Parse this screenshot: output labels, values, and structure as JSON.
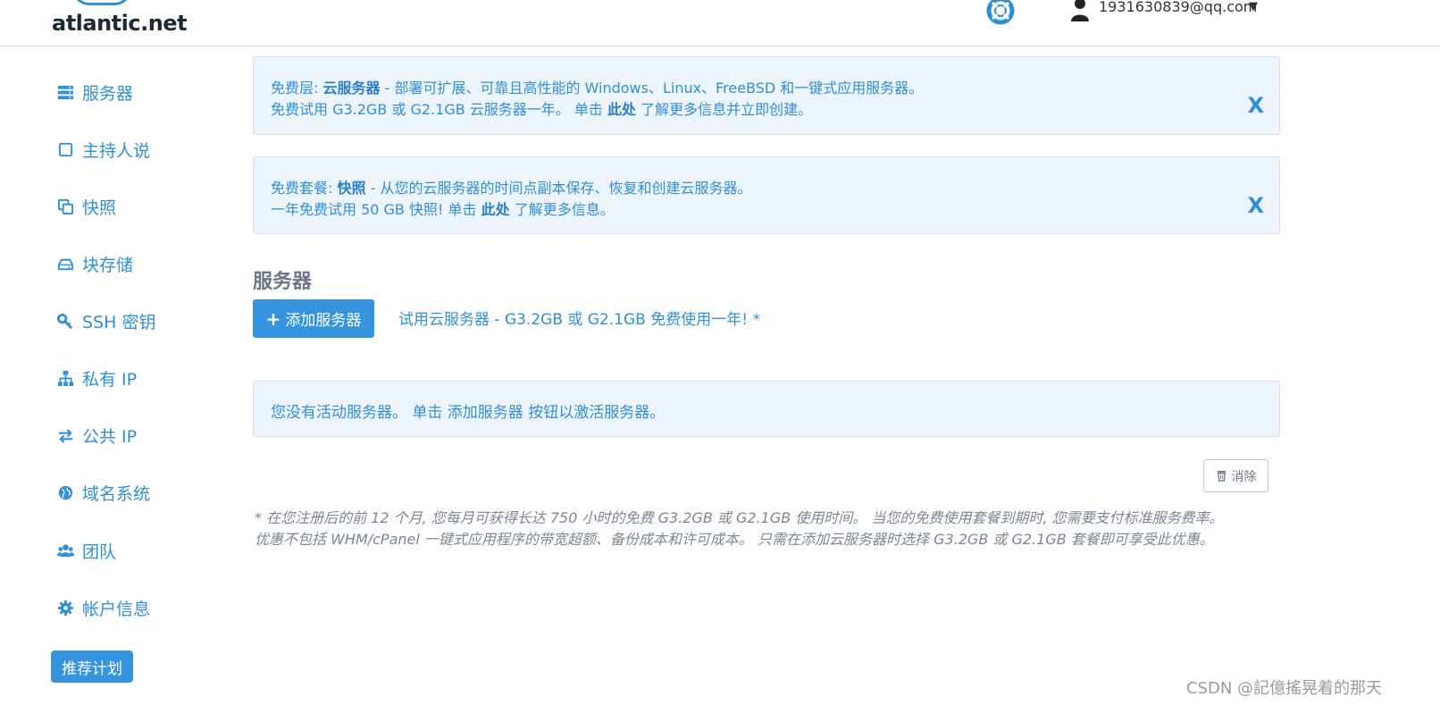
{
  "header": {
    "logo": "atlantic.net",
    "user_email": "1931630839@qq.com",
    "caret": "▼"
  },
  "sidebar": {
    "items": [
      {
        "label": "服务器",
        "icon": "server-icon"
      },
      {
        "label": "主持人说",
        "icon": "square-icon"
      },
      {
        "label": "快照",
        "icon": "copy-icon"
      },
      {
        "label": "块存储",
        "icon": "hard-drive-icon"
      },
      {
        "label": "SSH 密钥",
        "icon": "key-icon"
      },
      {
        "label": "私有 IP",
        "icon": "sitemap-icon"
      },
      {
        "label": "公共 IP",
        "icon": "exchange-icon"
      },
      {
        "label": "域名系统",
        "icon": "globe-icon"
      },
      {
        "label": "团队",
        "icon": "users-icon"
      },
      {
        "label": "帐户信息",
        "icon": "gear-icon"
      }
    ],
    "referral": "推荐计划"
  },
  "alerts": [
    {
      "prefix": "免费层:",
      "strong": "云服务器",
      "rest": " - 部署可扩展、可靠且高性能的 Windows、Linux、FreeBSD 和一键式应用服务器。",
      "line2_a": "免费试用 G3.2GB 或 G2.1GB 云服务器一年。 单击 ",
      "line2_strong": "此处",
      "line2_b": " 了解更多信息并立即创建。",
      "close": "X"
    },
    {
      "prefix": "免费套餐:",
      "strong": "快照",
      "rest": " - 从您的云服务器的时间点副本保存、恢复和创建云服务器。",
      "line2_a": "一年免费试用 50 GB 快照! 单击 ",
      "line2_strong": "此处",
      "line2_b": " 了解更多信息。",
      "close": "X"
    }
  ],
  "main": {
    "section_title": "服务器",
    "add_button": "添加服务器",
    "add_plus": "+",
    "trial_link": "试用云服务器 - G3.2GB 或 G2.1GB 免费使用一年! *",
    "empty_message": "您没有活动服务器。 单击 添加服务器 按钮以激活服务器。",
    "dismiss": "消除",
    "footnote_1": "* 在您注册后的前 12 个月, 您每月可获得长达 750 小时的免费 G3.2GB 或 G2.1GB 使用时间。 当您的免费使用套餐到期时, 您需要支付标准服务费率。",
    "footnote_2": "优惠不包括 WHM/cPanel 一键式应用程序的带宽超额、备份成本和许可成本。 只需在添加云服务器时选择 G3.2GB 或 G2.1GB 套餐即可享受此优惠。"
  },
  "watermark": "CSDN @記億搖晃着的那天",
  "colors": {
    "accent": "#2f8fd8",
    "button": "#3594dd",
    "alert_bg": "#edf4fb"
  }
}
